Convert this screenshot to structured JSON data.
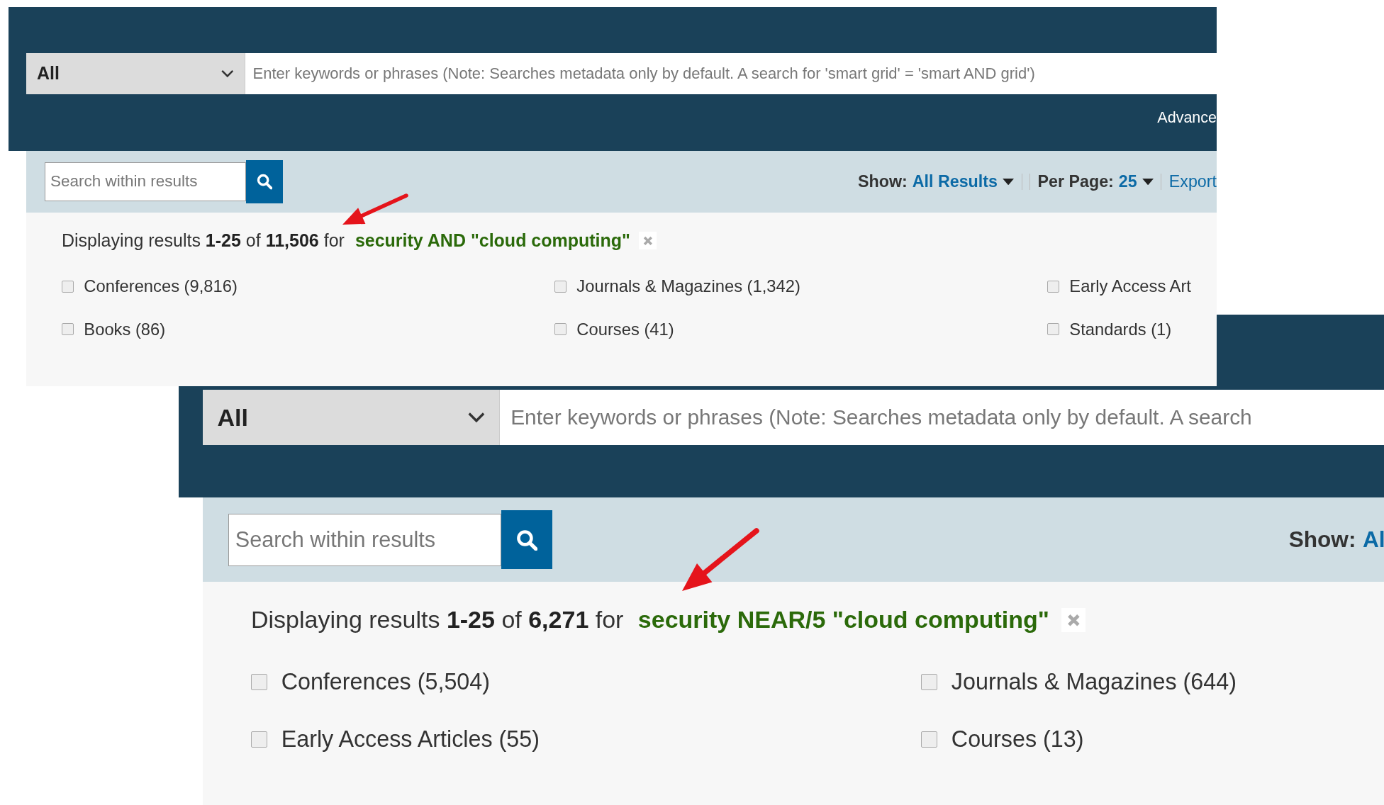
{
  "panels": [
    {
      "category_dropdown": {
        "value": "All"
      },
      "search": {
        "placeholder": "Enter keywords or phrases (Note: Searches metadata only by default. A search for 'smart grid' = 'smart AND grid')"
      },
      "advanced_link": "Advance",
      "search_within": {
        "placeholder": "Search within results"
      },
      "show": {
        "label": "Show:",
        "value": "All Results"
      },
      "per_page": {
        "label": "Per Page:",
        "value": "25"
      },
      "export_link": "Export",
      "summary": "Displaying results **1-25** of **11,506** for",
      "query": "security AND \"cloud computing\"",
      "facets": [
        {
          "label": "Conferences (9,816)",
          "checked": false
        },
        {
          "label": "Journals & Magazines (1,342)",
          "checked": false
        },
        {
          "label": "Early Access Art",
          "checked": false
        },
        {
          "label": "Books (86)",
          "checked": false
        },
        {
          "label": "Courses (41)",
          "checked": false
        },
        {
          "label": "Standards (1)",
          "checked": false
        }
      ]
    },
    {
      "category_dropdown": {
        "value": "All"
      },
      "search": {
        "placeholder": "Enter keywords or phrases (Note: Searches metadata only by default. A search"
      },
      "search_within": {
        "placeholder": "Search within results"
      },
      "show": {
        "label": "Show:",
        "value": "Al"
      },
      "summary": "Displaying results **1-25** of **6,271** for",
      "query": "security NEAR/5 \"cloud computing\"",
      "facets": [
        {
          "label": "Conferences (5,504)",
          "checked": false
        },
        {
          "label": "Journals & Magazines (644)",
          "checked": false
        },
        {
          "label": "Early Access Articles (55)",
          "checked": false
        },
        {
          "label": "Courses (13)",
          "checked": false
        }
      ]
    }
  ]
}
